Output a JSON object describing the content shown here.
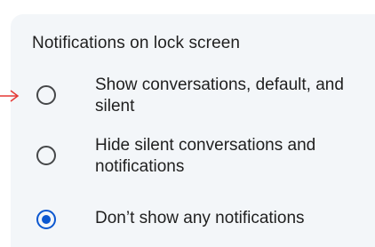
{
  "dialog": {
    "title": "Notifications on lock screen",
    "options": [
      {
        "label": "Show conversations, default, and silent",
        "checked": false
      },
      {
        "label": "Hide silent conversations and notifications",
        "checked": false
      },
      {
        "label": "Don’t show any notifications",
        "checked": true
      }
    ]
  },
  "colors": {
    "accent": "#0b57d0",
    "pointer": "#e53935"
  }
}
